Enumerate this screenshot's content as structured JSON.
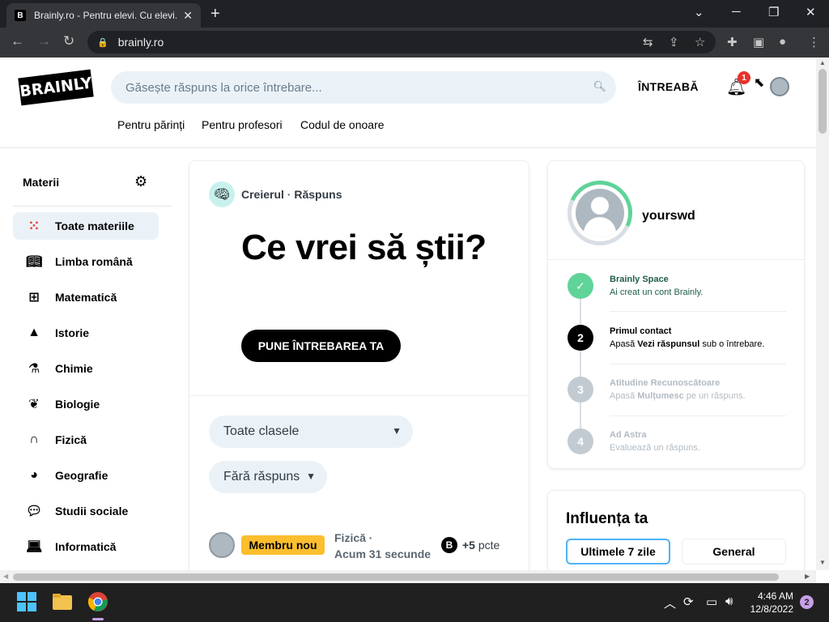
{
  "browser": {
    "tab_title": "Brainly.ro - Pentru elevi. Cu elevi.",
    "tab_favicon": "B",
    "close_tab": "✕",
    "new_tab": "+",
    "url": "brainly.ro"
  },
  "header": {
    "logo": "BRAINLY",
    "search_placeholder": "Găsește răspuns la orice întrebare...",
    "ask_label": "ÎNTREABĂ",
    "notification_count": "1",
    "links": [
      "Pentru părinți",
      "Pentru profesori",
      "Codul de onoare"
    ]
  },
  "sidebar": {
    "title": "Materii",
    "items": [
      {
        "label": "Toate materiile",
        "icon": "grid-dots-icon"
      },
      {
        "label": "Limba română",
        "icon": "book-icon"
      },
      {
        "label": "Matematică",
        "icon": "calculator-icon"
      },
      {
        "label": "Istorie",
        "icon": "pyramid-icon"
      },
      {
        "label": "Chimie",
        "icon": "flask-icon"
      },
      {
        "label": "Biologie",
        "icon": "leaf-icon"
      },
      {
        "label": "Fizică",
        "icon": "magnet-icon"
      },
      {
        "label": "Geografie",
        "icon": "globe-icon"
      },
      {
        "label": "Studii sociale",
        "icon": "chat-bubbles-icon"
      },
      {
        "label": "Informatică",
        "icon": "laptop-icon"
      }
    ]
  },
  "main": {
    "breadcrumb_brain": "Creierul",
    "breadcrumb_sep": " · ",
    "breadcrumb_answer": "Răspuns",
    "hero_title": "Ce vrei să știi?",
    "cta": "PUNE ÎNTREBAREA TA",
    "filter_class": "Toate clasele",
    "filter_answer": "Fără răspuns",
    "question": {
      "badge": "Membru nou",
      "subject": "Fizică ·",
      "time": "Acum 31 secunde",
      "points_icon": "B",
      "points_value": "+5",
      "points_unit": "pcte"
    }
  },
  "profile": {
    "username": "yourswd",
    "steps": [
      {
        "num": "✓",
        "title": "Brainly Space",
        "desc": "Ai creat un cont Brainly.",
        "state": "done"
      },
      {
        "num": "2",
        "title": "Primul contact",
        "desc_pre": "Apasă ",
        "desc_bold": "Vezi răspunsul",
        "desc_post": " sub o întrebare.",
        "state": "active"
      },
      {
        "num": "3",
        "title": "Atitudine Recunoscătoare",
        "desc_pre": "Apasă ",
        "desc_bold": "Mulțumesc",
        "desc_post": " pe un răspuns.",
        "state": "locked"
      },
      {
        "num": "4",
        "title": "Ad Astra",
        "desc": "Evaluează un răspuns.",
        "state": "locked"
      }
    ]
  },
  "influence": {
    "title": "Influența ta",
    "tab_week": "Ultimele 7 zile",
    "tab_general": "General"
  },
  "taskbar": {
    "time": "4:46 AM",
    "date": "12/8/2022",
    "notifications": "2"
  },
  "colors": {
    "accent_green": "#60d399",
    "badge_yellow": "#fbbe2e",
    "search_bg": "#ebf2f7",
    "notification_red": "#e8322b"
  }
}
